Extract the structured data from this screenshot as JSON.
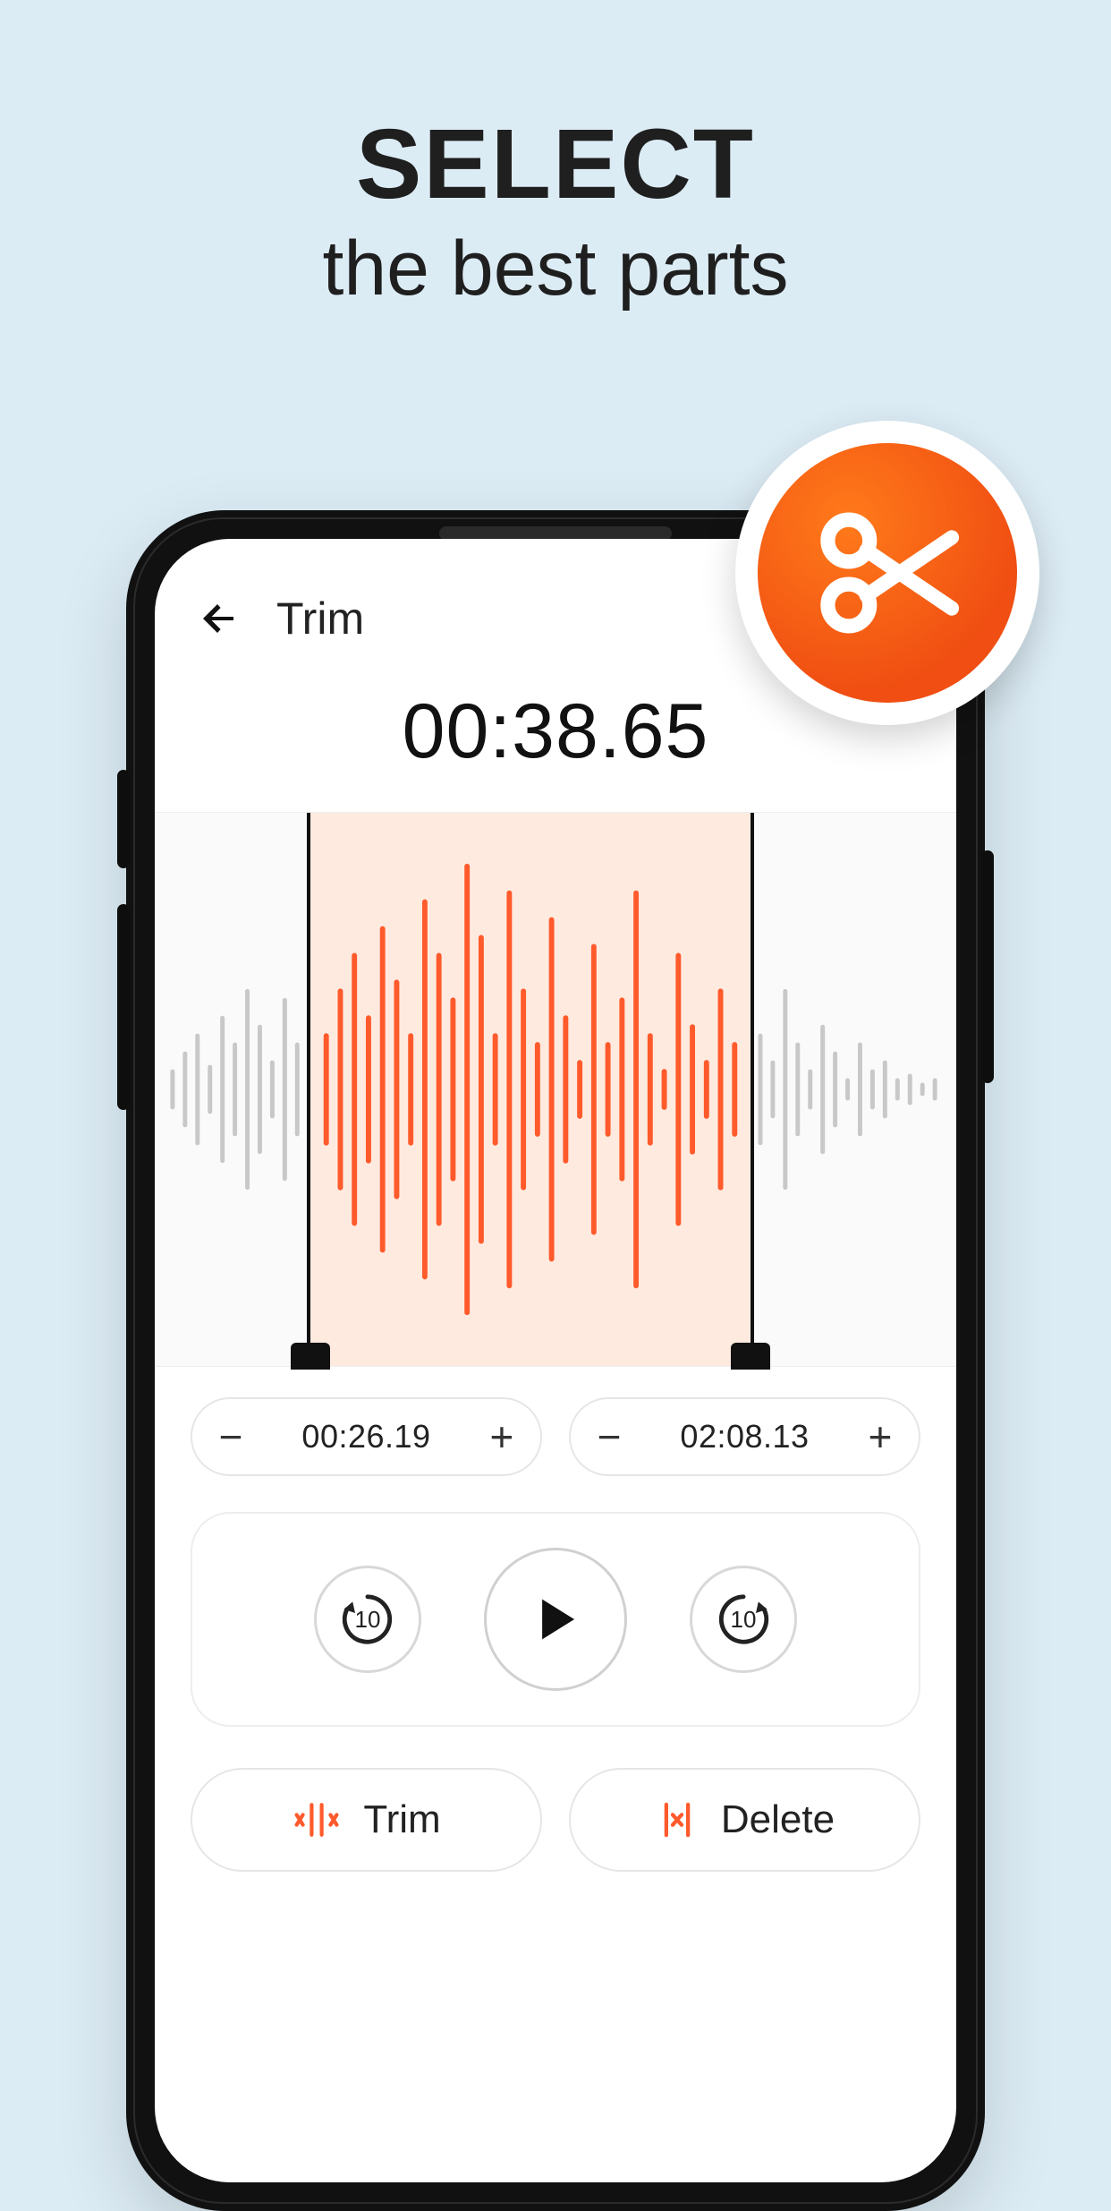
{
  "promo": {
    "line1": "SELECT",
    "line2": "the best parts"
  },
  "badge": {
    "icon": "scissors-icon"
  },
  "app": {
    "title": "Trim",
    "playhead_time": "00:38.65",
    "selection": {
      "start_time": "00:26.19",
      "end_time": "02:08.13"
    },
    "skip_seconds": "10",
    "actions": {
      "trim_label": "Trim",
      "delete_label": "Delete"
    }
  }
}
